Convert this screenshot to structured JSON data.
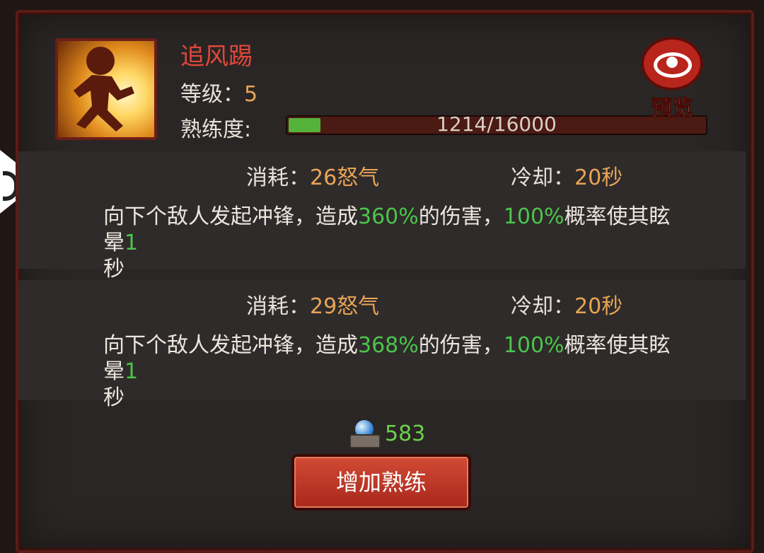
{
  "skill": {
    "name": "追风踢",
    "level_label": "等级：",
    "level_value": "5",
    "proficiency_label": "熟练度:",
    "proficiency_text": "1214/16000",
    "proficiency_progress": 0.0759
  },
  "preview": {
    "label": "预览",
    "icon": "eye-icon"
  },
  "levels": [
    {
      "cost_label": "消耗：",
      "cost_value": "26怒气",
      "cooldown_label": "冷却：",
      "cooldown_value": "20秒",
      "desc_parts": [
        "向下个敌人发起冲锋，造成",
        "360%",
        "的伤害，",
        "100%",
        "概率使其眩晕",
        "1",
        "秒"
      ]
    },
    {
      "cost_label": "消耗：",
      "cost_value": "29怒气",
      "cooldown_label": "冷却：",
      "cooldown_value": "20秒",
      "desc_parts": [
        "向下个敌人发起冲锋，造成",
        "368%",
        "的伤害，",
        "100%",
        "概率使其眩晕",
        "1",
        "秒"
      ]
    }
  ],
  "currency": {
    "icon": "crystal-orb-icon",
    "amount": "583"
  },
  "action_button": {
    "label": "增加熟练"
  },
  "colors": {
    "accent_red": "#e0473a",
    "orange": "#e8a456",
    "green": "#4bc54b"
  }
}
